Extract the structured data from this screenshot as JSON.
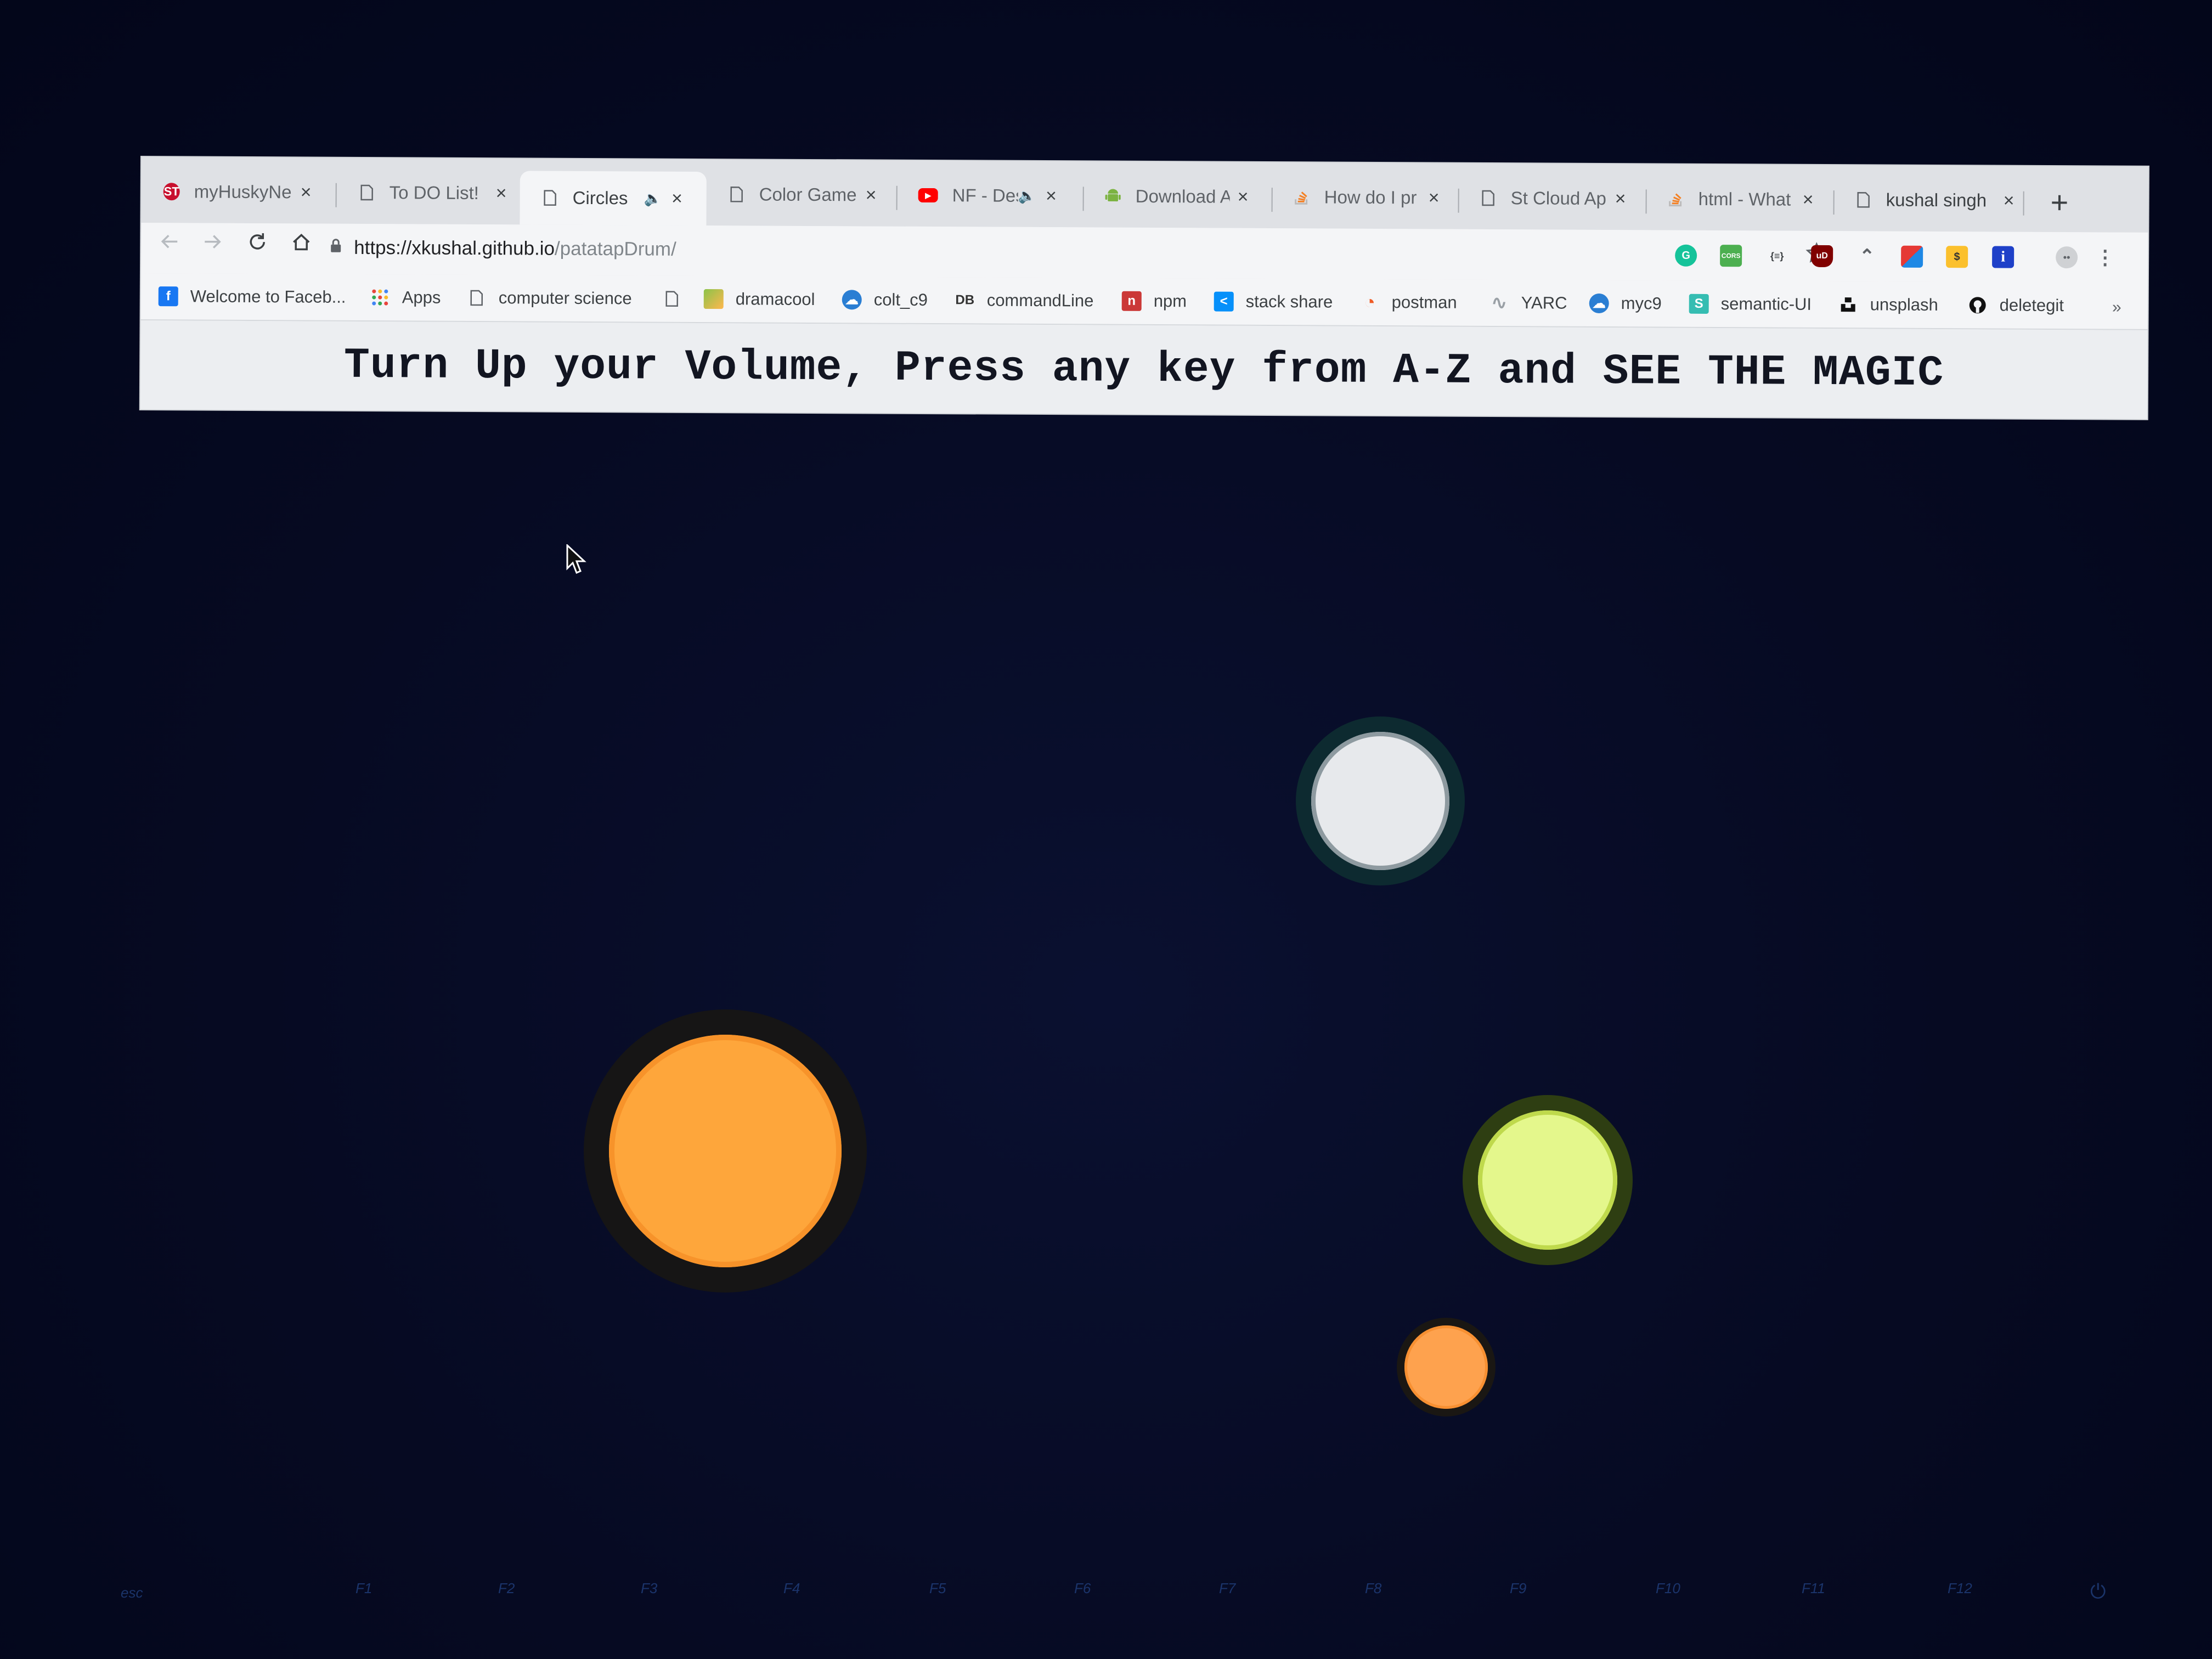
{
  "browser": {
    "tabs": [
      {
        "title": "myHuskyNe",
        "favicon": "husky-icon",
        "color": "#c8102e",
        "audio": false,
        "active": false
      },
      {
        "title": "To DO List!",
        "favicon": "page-icon",
        "color": "#5f6368",
        "audio": false,
        "active": false
      },
      {
        "title": "Circles",
        "favicon": "page-icon",
        "color": "#5f6368",
        "audio": true,
        "active": true
      },
      {
        "title": "Color Game",
        "favicon": "page-icon",
        "color": "#5f6368",
        "audio": false,
        "active": false
      },
      {
        "title": "NF - Des",
        "favicon": "youtube-icon",
        "color": "#ff0000",
        "audio": true,
        "active": false
      },
      {
        "title": "Download A",
        "favicon": "android-icon",
        "color": "#7cb342",
        "audio": false,
        "active": false
      },
      {
        "title": "How do I pr",
        "favicon": "stackoverflow-icon",
        "color": "#f48024",
        "audio": false,
        "active": false
      },
      {
        "title": "St Cloud Ap",
        "favicon": "page-icon",
        "color": "#5f6368",
        "audio": false,
        "active": false
      },
      {
        "title": "html - What",
        "favicon": "stackoverflow-icon",
        "color": "#f48024",
        "audio": false,
        "active": false
      },
      {
        "title": "kushal singh",
        "favicon": "page-icon",
        "color": "#5f6368",
        "audio": false,
        "active": false
      }
    ],
    "new_tab_label": "+",
    "close_label": "×",
    "audio_label": "🔈",
    "url": {
      "host": "https://xkushal.github.io",
      "path": "/patatapDrum/"
    },
    "bookmarks": [
      {
        "label": "Welcome to Faceb...",
        "icon": "facebook-icon",
        "color": "#1877f2",
        "glyph": "f"
      },
      {
        "label": "Apps",
        "icon": "apps-grid-icon",
        "color": "#e8453c",
        "glyph": "⋮⋮"
      },
      {
        "label": "computer science",
        "icon": "page-icon",
        "color": "#5f6368",
        "glyph": ""
      },
      {
        "label": "",
        "icon": "page-icon",
        "color": "#5f6368",
        "glyph": ""
      },
      {
        "label": "dramacool",
        "icon": "dramacool-icon",
        "color": "#8bc34a",
        "glyph": ""
      },
      {
        "label": "colt_c9",
        "icon": "cloud9-icon",
        "color": "#2a7ed3",
        "glyph": "☁"
      },
      {
        "label": "commandLine",
        "icon": "db-icon",
        "color": "#333333",
        "glyph": "DB"
      },
      {
        "label": "npm",
        "icon": "npm-icon",
        "color": "#cb3837",
        "glyph": "n"
      },
      {
        "label": "stack share",
        "icon": "stackshare-icon",
        "color": "#0690fa",
        "glyph": "<"
      },
      {
        "label": "postman",
        "icon": "postman-icon",
        "color": "#ef5b25",
        "glyph": "◔"
      },
      {
        "label": "YARC",
        "icon": "yarc-icon",
        "color": "#9aa0a6",
        "glyph": "∿"
      },
      {
        "label": "myc9",
        "icon": "cloud9-icon",
        "color": "#2a7ed3",
        "glyph": "☁"
      },
      {
        "label": "semantic-UI",
        "icon": "semantic-ui-icon",
        "color": "#35bdb2",
        "glyph": "S"
      },
      {
        "label": "unsplash",
        "icon": "unsplash-icon",
        "color": "#111111",
        "glyph": "▟"
      },
      {
        "label": "deletegit",
        "icon": "github-icon",
        "color": "#111111",
        "glyph": "●"
      }
    ],
    "bookmarks_more": "»",
    "extensions": [
      {
        "name": "grammarly-icon",
        "color": "#15c39a",
        "glyph": "G"
      },
      {
        "name": "cors-icon",
        "color": "#4caf50",
        "glyph": "CORS"
      },
      {
        "name": "json-viewer-icon",
        "color": "#5f6368",
        "glyph": "{≡}"
      },
      {
        "name": "ublock-icon",
        "color": "#800000",
        "glyph": "uD"
      },
      {
        "name": "wave-icon",
        "color": "#9aa0a6",
        "glyph": "⌃"
      },
      {
        "name": "color-picker-icon",
        "color": "#e53935",
        "glyph": "▣"
      },
      {
        "name": "dollar-icon",
        "color": "#fbc02d",
        "glyph": "$"
      },
      {
        "name": "info-icon",
        "color": "#1e40c8",
        "glyph": "i"
      }
    ]
  },
  "page": {
    "headline": "Turn Up your Volume, Press any key from A-Z and SEE THE MAGIC"
  },
  "circles": [
    {
      "name": "white-circle",
      "color": "#e7e9ec"
    },
    {
      "name": "orange-large-circle",
      "color": "#fea63b"
    },
    {
      "name": "lime-circle",
      "color": "#e4f78c"
    },
    {
      "name": "orange-small-circle",
      "color": "#fea24e"
    }
  ],
  "keyboard": {
    "keys": [
      "esc",
      "F1",
      "F2",
      "F3",
      "F4",
      "F5",
      "F6",
      "F7",
      "F8",
      "F9",
      "F10",
      "F11",
      "F12"
    ]
  }
}
